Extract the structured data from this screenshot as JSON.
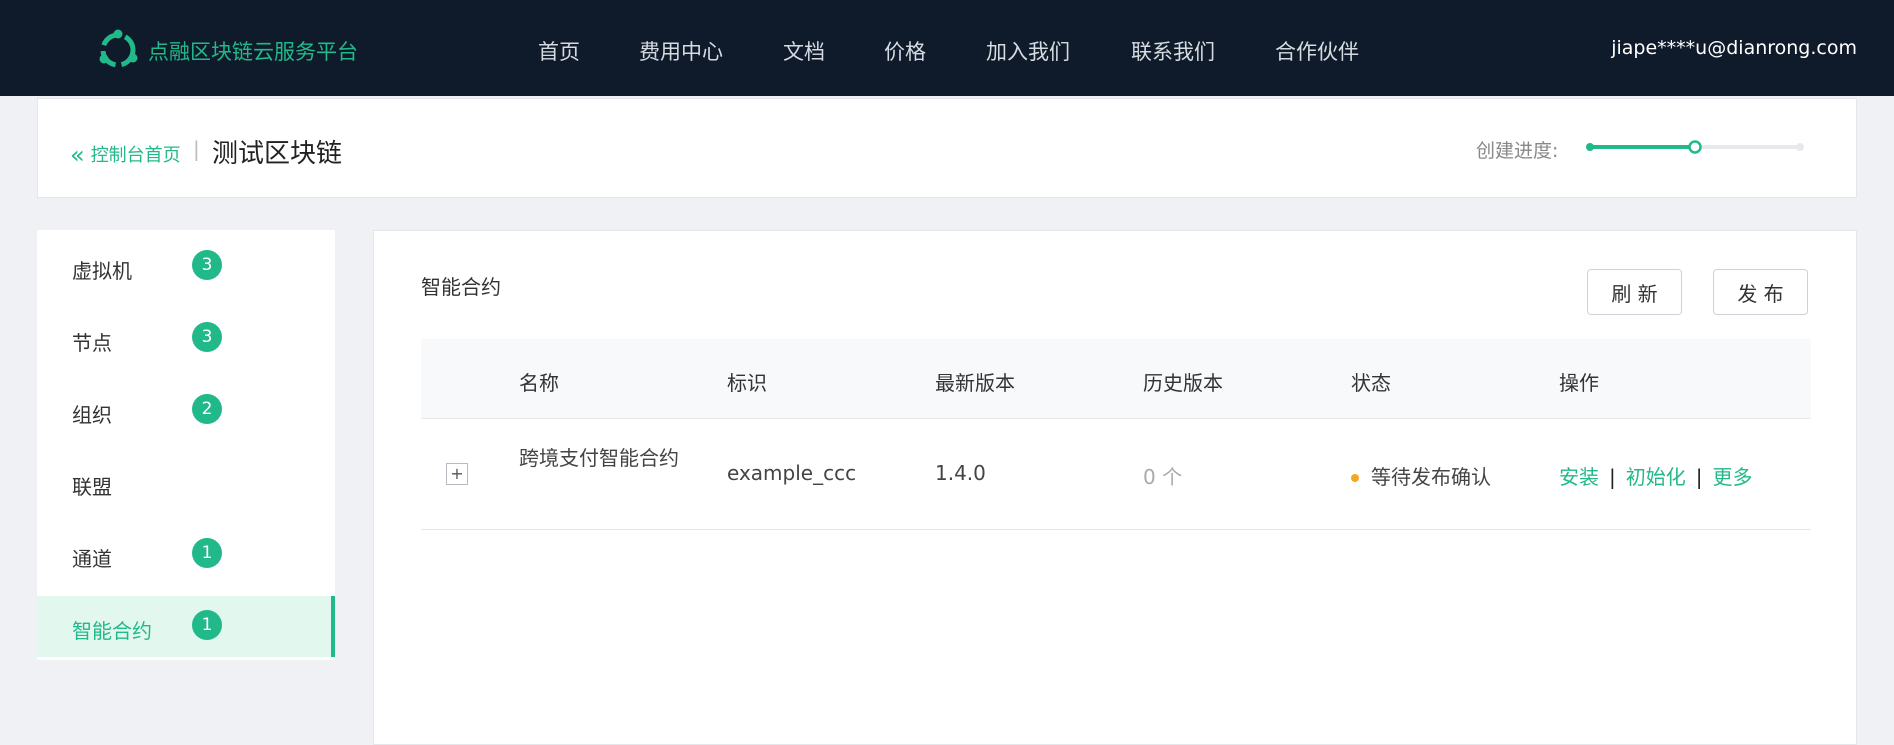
{
  "header": {
    "brand": "点融区块链云服务平台",
    "nav": [
      "首页",
      "费用中心",
      "文档",
      "价格",
      "加入我们",
      "联系我们",
      "合作伙伴"
    ],
    "user_email": "jiape****u@dianrong.com",
    "logo_icon": "blockchain-logo-icon"
  },
  "breadcrumb": {
    "back_label": "控制台首页",
    "separator": "|",
    "page_title": "测试区块链",
    "progress_label": "创建进度:",
    "progress_step": 2,
    "progress_steps_total": 3
  },
  "sidebar": {
    "items": [
      {
        "label": "虚拟机",
        "count": "3"
      },
      {
        "label": "节点",
        "count": "3"
      },
      {
        "label": "组织",
        "count": "2"
      },
      {
        "label": "联盟",
        "count": ""
      },
      {
        "label": "通道",
        "count": "1"
      },
      {
        "label": "智能合约",
        "count": "1",
        "active": true
      }
    ]
  },
  "main": {
    "section_title": "智能合约",
    "refresh_label": "刷 新",
    "publish_label": "发 布",
    "table": {
      "headers": [
        "名称",
        "标识",
        "最新版本",
        "历史版本",
        "状态",
        "操作"
      ],
      "rows": [
        {
          "expand": "+",
          "name": "跨境支付智能合约",
          "id": "example_ccc",
          "latest_version": "1.4.0",
          "history_versions": "0 个",
          "status": "等待发布确认",
          "actions": [
            "安装",
            "初始化",
            "更多"
          ]
        }
      ]
    }
  },
  "colors": {
    "accent": "#21b989",
    "header_bg": "#0f1a2a",
    "status_pending": "#f5a623"
  }
}
